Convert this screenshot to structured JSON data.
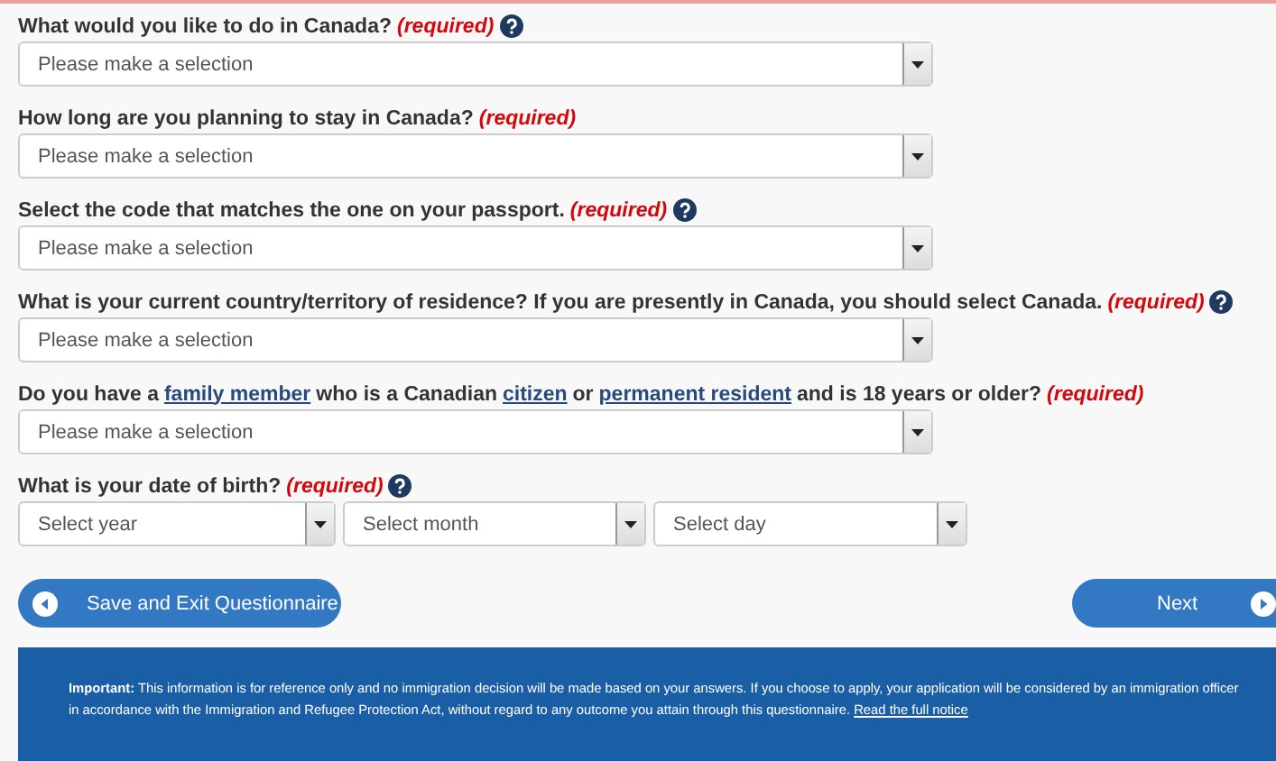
{
  "questions": [
    {
      "label": [
        {
          "kind": "text",
          "text": "What would you like to do in Canada?"
        }
      ],
      "required": "(required)",
      "help": true,
      "selects": [
        "Please make a selection"
      ]
    },
    {
      "label": [
        {
          "kind": "text",
          "text": "How long are you planning to stay in Canada?"
        }
      ],
      "required": "(required)",
      "help": false,
      "selects": [
        "Please make a selection"
      ]
    },
    {
      "label": [
        {
          "kind": "text",
          "text": "Select the code that matches the one on your passport."
        }
      ],
      "required": "(required)",
      "help": true,
      "selects": [
        "Please make a selection"
      ]
    },
    {
      "label": [
        {
          "kind": "text",
          "text": "What is your current country/territory of residence? If you are presently in Canada, you should select Canada."
        }
      ],
      "required": "(required)",
      "help": true,
      "selects": [
        "Please make a selection"
      ]
    },
    {
      "label": [
        {
          "kind": "text",
          "text": "Do you have a"
        },
        {
          "kind": "link",
          "text": "family member"
        },
        {
          "kind": "text",
          "text": "who is a Canadian"
        },
        {
          "kind": "link",
          "text": "citizen"
        },
        {
          "kind": "text",
          "text": "or"
        },
        {
          "kind": "link",
          "text": "permanent resident"
        },
        {
          "kind": "text",
          "text": "and is 18 years or older?"
        }
      ],
      "required": "(required)",
      "help": false,
      "selects": [
        "Please make a selection"
      ]
    },
    {
      "label": [
        {
          "kind": "text",
          "text": "What is your date of birth?"
        }
      ],
      "required": "(required)",
      "help": true,
      "selects": [
        "Select year",
        "Select month",
        "Select day"
      ]
    }
  ],
  "buttons": {
    "back": "Save and Exit Questionnaire",
    "next": "Next"
  },
  "notice": {
    "text": "**Important:** This information is for reference only and no immigration decision will be made based on your answers. If you choose to apply, your application will be considered by an immigration officer in accordance with the Immigration and Refugee Protection Act, without regard to any outcome you attain through this questionnaire.",
    "link": "Read the full notice"
  }
}
